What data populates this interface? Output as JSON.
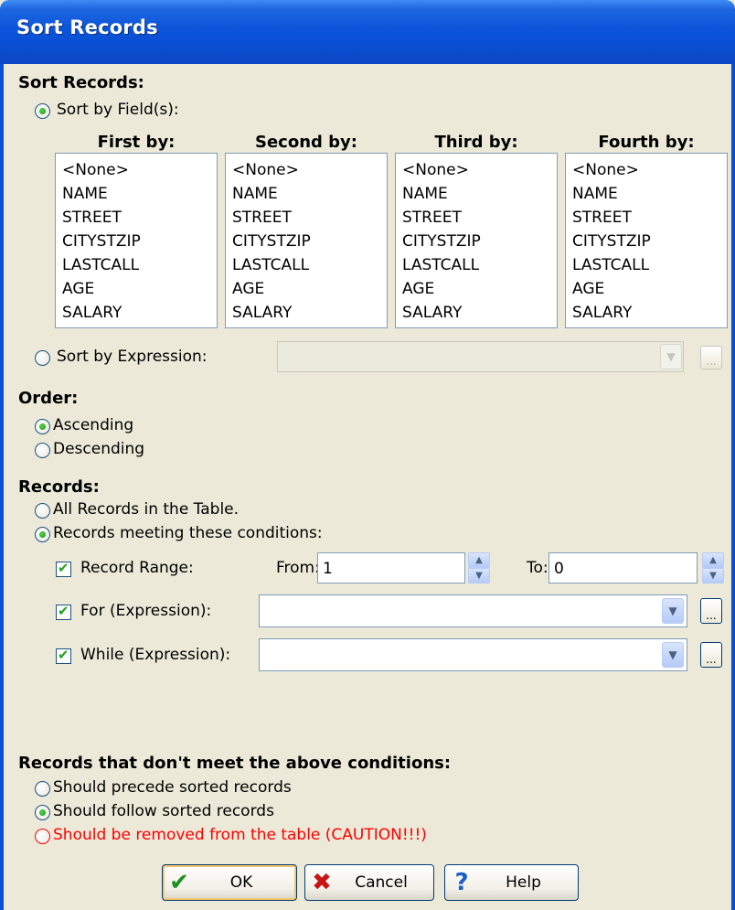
{
  "window": {
    "title": "Sort Records"
  },
  "sort_records": {
    "heading": "Sort Records:",
    "by_fields_label": "Sort by Field(s):",
    "columns": [
      {
        "header": "First by:"
      },
      {
        "header": "Second by:"
      },
      {
        "header": "Third by:"
      },
      {
        "header": "Fourth by:"
      }
    ],
    "field_options": [
      "<None>",
      "NAME",
      "STREET",
      "CITYSTZIP",
      "LASTCALL",
      "AGE",
      "SALARY"
    ],
    "by_expression_label": "Sort by Expression:",
    "expression_value": "",
    "ellipsis": "..."
  },
  "order": {
    "heading": "Order:",
    "ascending": "Ascending",
    "descending": "Descending",
    "selected": "ascending"
  },
  "records": {
    "heading": "Records:",
    "all": "All Records in the Table.",
    "meeting": "Records meeting these conditions:",
    "range_label": "Record Range:",
    "from_label": "From:",
    "from_value": "1",
    "to_label": "To:",
    "to_value": "0",
    "for_label": "For (Expression):",
    "for_value": "",
    "while_label": "While (Expression):",
    "while_value": ""
  },
  "unmatched": {
    "heading": "Records that don't meet the above conditions:",
    "precede": "Should precede sorted records",
    "follow": "Should follow sorted records",
    "remove": "Should be removed from the table (CAUTION!!!)",
    "remove_color": "#ff0000"
  },
  "buttons": {
    "ok": "OK",
    "cancel": "Cancel",
    "help": "Help"
  },
  "icons": {
    "ok": "checkmark-icon",
    "cancel": "red-x-icon",
    "help": "question-mark-icon"
  }
}
